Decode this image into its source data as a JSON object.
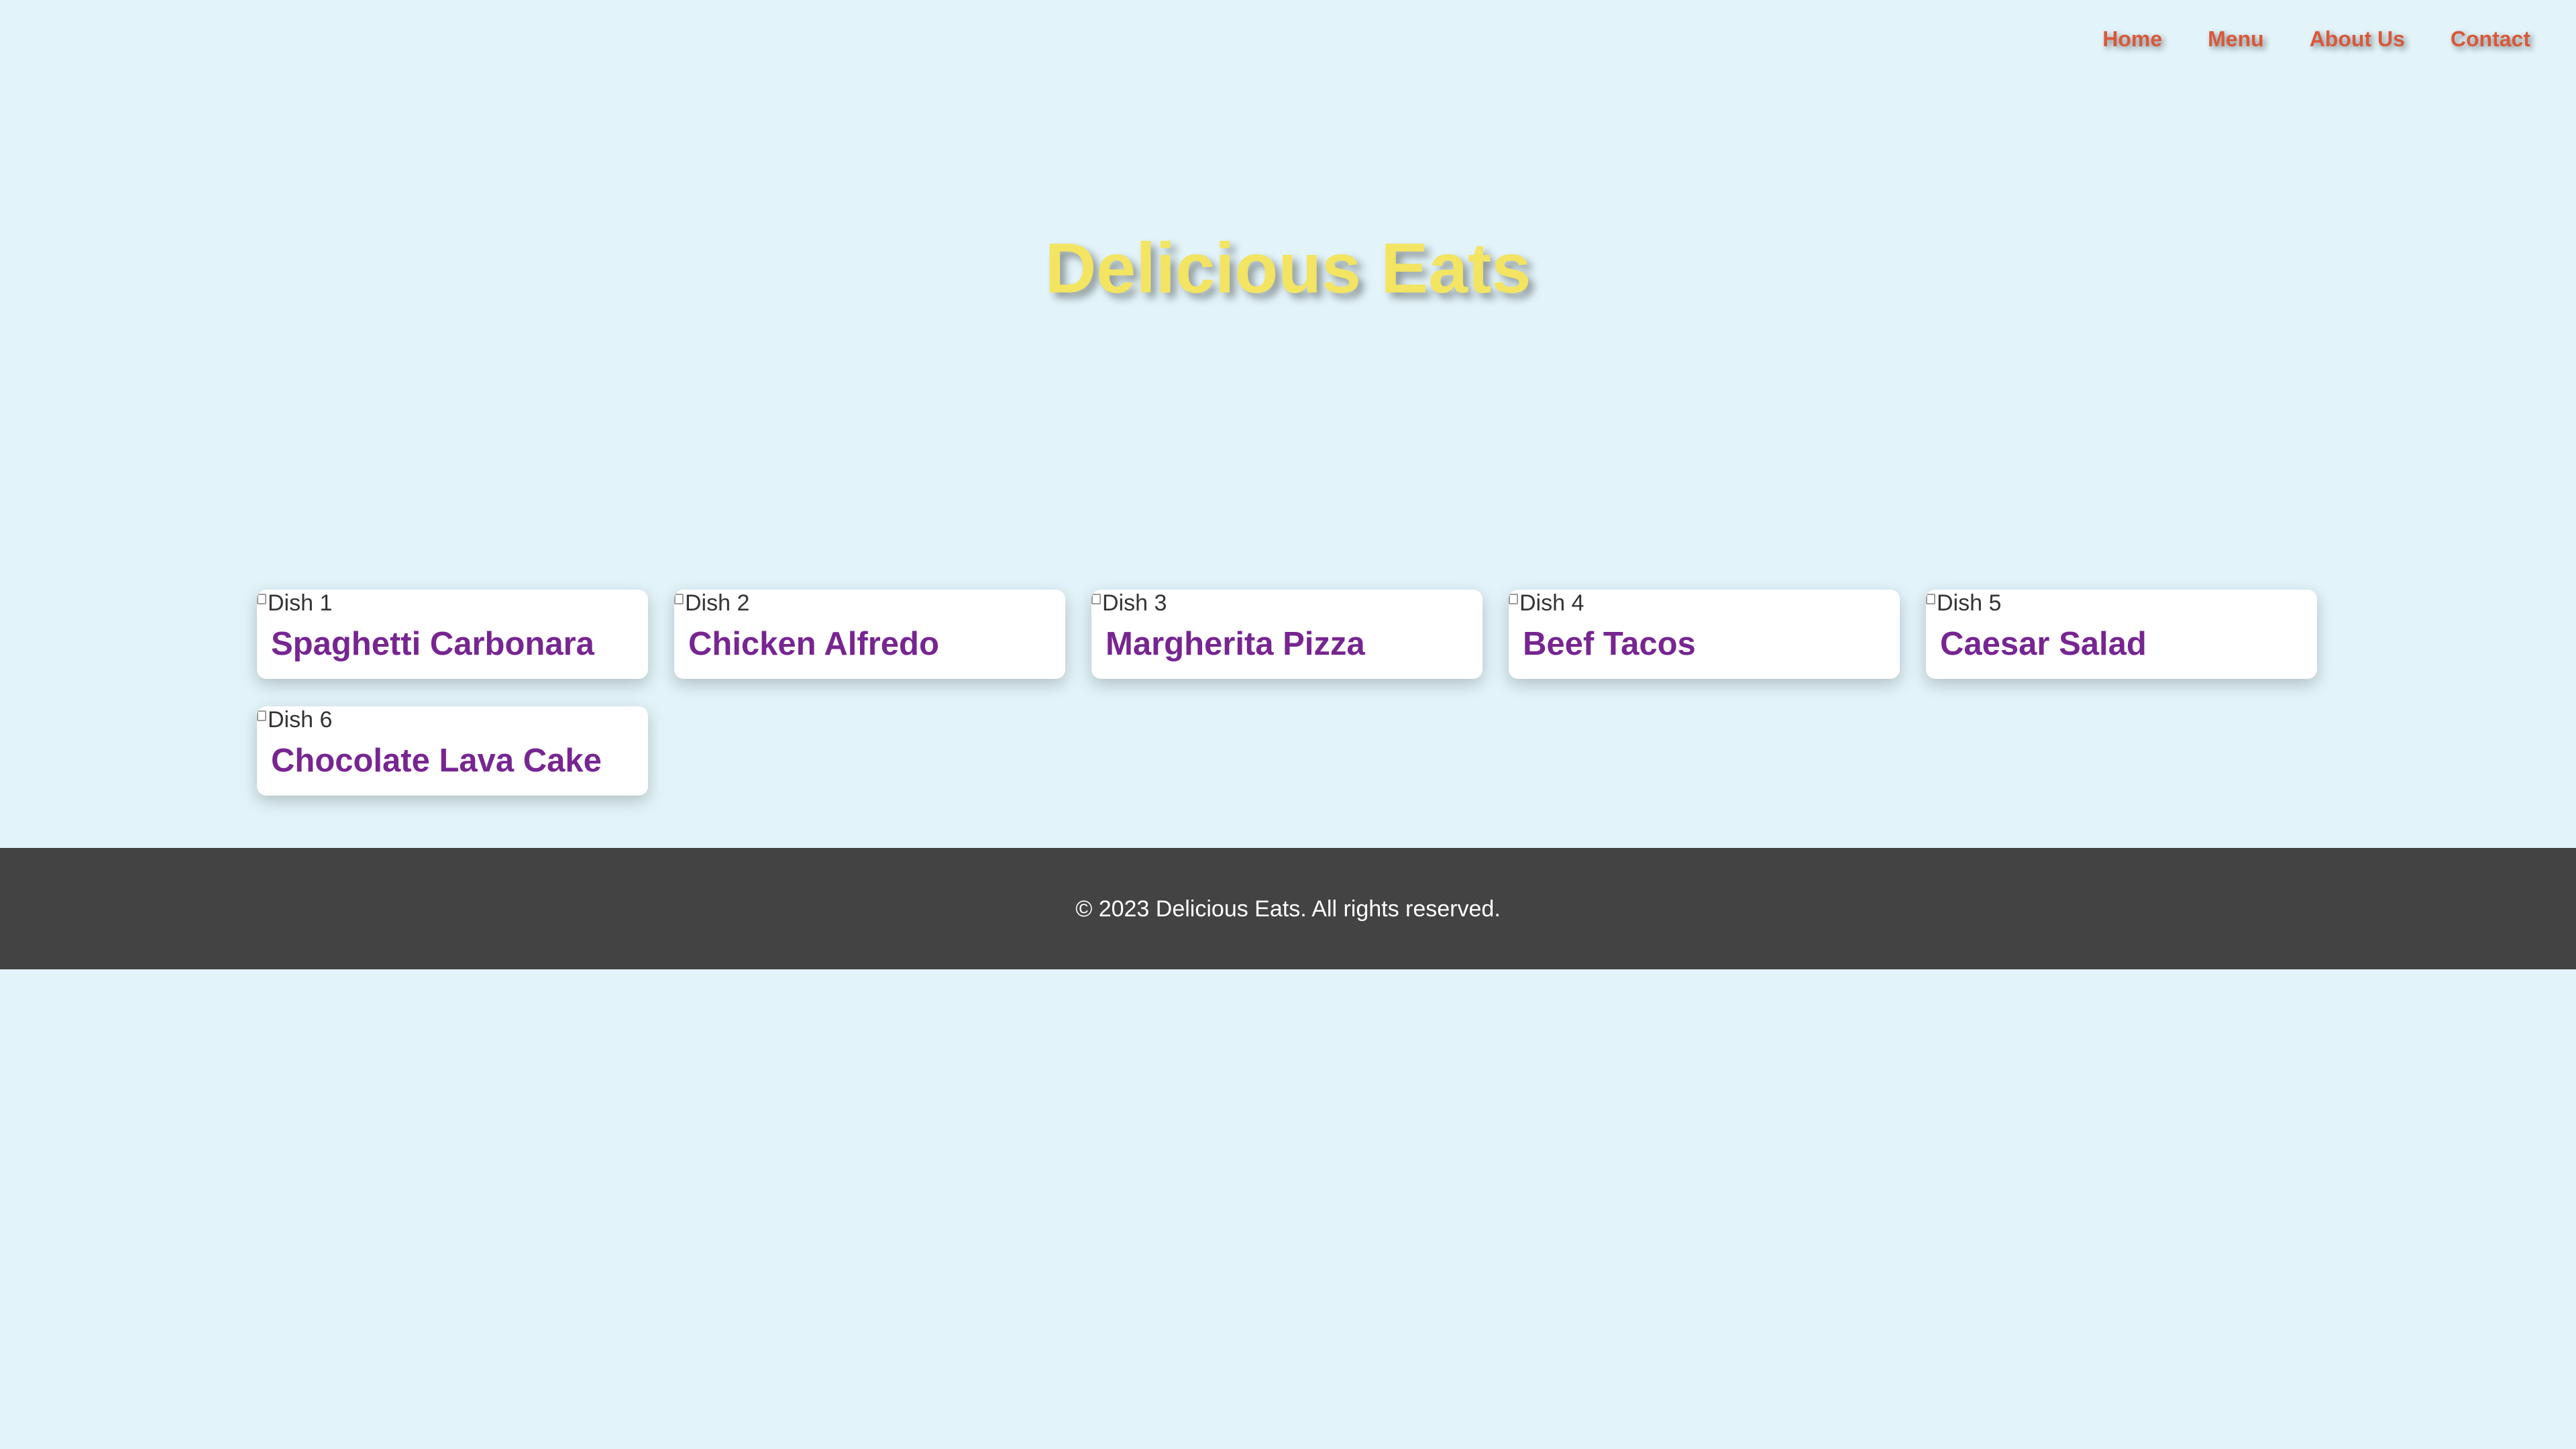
{
  "nav": {
    "items": [
      {
        "label": "Home"
      },
      {
        "label": "Menu"
      },
      {
        "label": "About Us"
      },
      {
        "label": "Contact"
      }
    ]
  },
  "hero": {
    "title": "Delicious Eats"
  },
  "dishes": [
    {
      "alt": "Dish 1",
      "name": "Spaghetti Carbonara"
    },
    {
      "alt": "Dish 2",
      "name": "Chicken Alfredo"
    },
    {
      "alt": "Dish 3",
      "name": "Margherita Pizza"
    },
    {
      "alt": "Dish 4",
      "name": "Beef Tacos"
    },
    {
      "alt": "Dish 5",
      "name": "Caesar Salad"
    },
    {
      "alt": "Dish 6",
      "name": "Chocolate Lava Cake"
    }
  ],
  "footer": {
    "text": "© 2023 Delicious Eats. All rights reserved."
  },
  "colors": {
    "background": "#e2f4f9",
    "nav_link": "#d9583a",
    "hero_title": "#f3e462",
    "dish_name": "#772591",
    "footer_bg": "#434343",
    "footer_text": "#ffffff"
  },
  "icons": {
    "broken_image": "broken-image-icon"
  }
}
